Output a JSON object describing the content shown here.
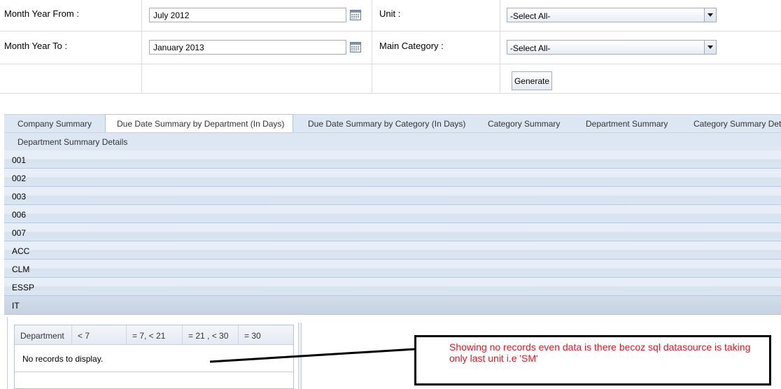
{
  "filters": {
    "month_year_from": {
      "label": "Month Year From :",
      "value": "July 2012"
    },
    "month_year_to": {
      "label": "Month Year To :",
      "value": "January 2013"
    },
    "unit": {
      "label": "Unit :",
      "value": "-Select All-"
    },
    "main_category": {
      "label": "Main Category :",
      "value": "-Select All-"
    },
    "generate_label": "Generate",
    "calendar_icon": "calendar-icon",
    "dropdown_icon": "chevron-down-icon"
  },
  "tabs": [
    {
      "label": "Company Summary",
      "selected": false
    },
    {
      "label": "Due Date Summary by Department (In Days)",
      "selected": true
    },
    {
      "label": "Due Date Summary by Category (In Days)",
      "selected": false
    },
    {
      "label": "Category Summary",
      "selected": false
    },
    {
      "label": "Department Summary",
      "selected": false
    },
    {
      "label": "Category Summary Details",
      "selected": false
    },
    {
      "label": "Department Summary Details",
      "selected": false
    }
  ],
  "groups": [
    {
      "label": "001"
    },
    {
      "label": "002"
    },
    {
      "label": "003"
    },
    {
      "label": "006"
    },
    {
      "label": "007"
    },
    {
      "label": "ACC"
    },
    {
      "label": "CLM"
    },
    {
      "label": "ESSP"
    },
    {
      "label": "IT",
      "expanded": true
    }
  ],
  "detail_grid": {
    "columns": [
      "Department",
      "< 7",
      "= 7, < 21",
      "= 21 , < 30",
      "= 30"
    ],
    "empty_message": "No records to display."
  },
  "annotation": {
    "text": "Showing no records even data is there becoz sql datasource is taking only last unit i.e 'SM'",
    "color": "#e8141e"
  },
  "colors": {
    "tab_strip": "#dde7f4",
    "group_row": "#e8eef7",
    "border": "#a5acb5"
  }
}
